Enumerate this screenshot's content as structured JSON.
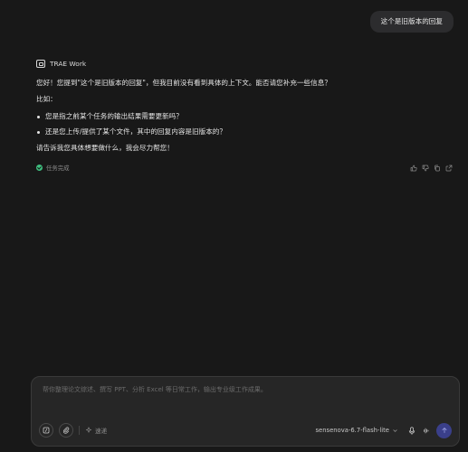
{
  "user_message": {
    "text": "这个是旧版本的回复"
  },
  "assistant": {
    "name": "TRAE Work",
    "intro": "您好！您提到\"这个是旧版本的回复\"，但我目前没有看到具体的上下文。能否请您补充一些信息？",
    "example_label": "比如：",
    "bullets": [
      "您是指之前某个任务的输出结果需要更新吗？",
      "还是您上传/提供了某个文件，其中的回复内容是旧版本的？"
    ],
    "closing": "请告诉我您具体想要做什么，我会尽力帮您！",
    "status": "任务完成"
  },
  "composer": {
    "placeholder": "帮你整理论文综述、撰写 PPT、分析 Excel 等日常工作，输出专业级工作成果。",
    "think_label": "速递",
    "model_label": "sensenova-6.7-flash-lite"
  },
  "colors": {
    "background": "#181818",
    "bubble": "#2c2c2e",
    "success": "#3fbf7f",
    "send_button": "#3a3f8a"
  },
  "icons": {
    "assistant_logo": "trae-logo-icon",
    "status": "check-circle-icon",
    "actions": [
      "thumbs-up-icon",
      "thumbs-down-icon",
      "copy-icon",
      "export-icon"
    ],
    "composer_left": [
      "slash-command-icon",
      "paperclip-icon",
      "sparkle-icon"
    ],
    "composer_right": [
      "chevron-down-icon",
      "microphone-icon",
      "waveform-icon",
      "arrow-up-icon"
    ]
  }
}
